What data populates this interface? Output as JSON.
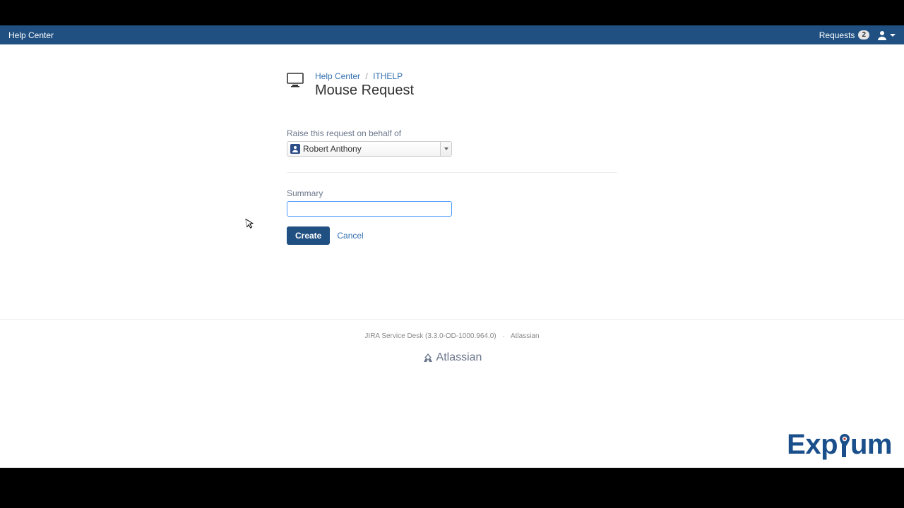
{
  "nav": {
    "help_center": "Help Center",
    "requests_label": "Requests",
    "requests_count": "2"
  },
  "breadcrumb": {
    "help_center": "Help Center",
    "project": "ITHELP"
  },
  "page": {
    "title": "Mouse Request"
  },
  "form": {
    "behalf_label": "Raise this request on behalf of",
    "behalf_value": "Robert Anthony",
    "summary_label": "Summary",
    "summary_value": "",
    "create": "Create",
    "cancel": "Cancel"
  },
  "footer": {
    "product": "JIRA Service Desk (3.3.0-OD-1000.964.0)",
    "vendor": "Atlassian",
    "brand": "Atlassian"
  },
  "watermark": {
    "pre": "Exp",
    "post": "um"
  }
}
